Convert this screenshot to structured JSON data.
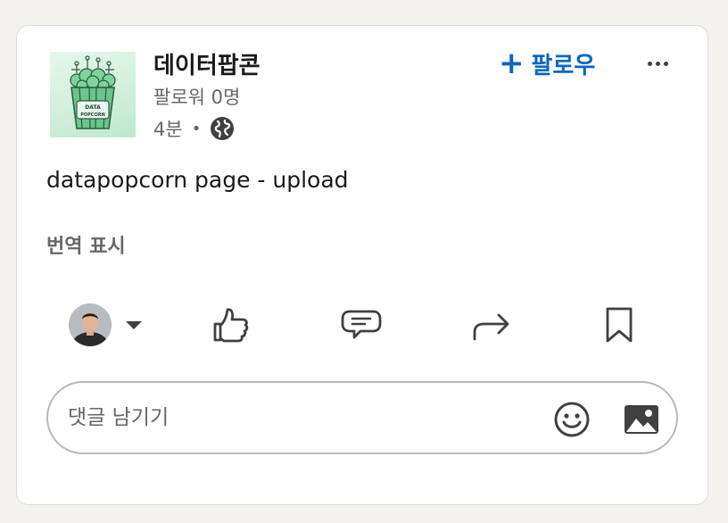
{
  "post": {
    "author_name": "데이터팝콘",
    "followers": "팔로워 0명",
    "time": "4분",
    "separator": "•",
    "visibility_icon": "globe-icon",
    "follow_label": "팔로우",
    "follow_icon": "plus-icon",
    "more_icon": "ellipsis-icon",
    "text": "datapopcorn page - upload",
    "translate_label": "번역 표시",
    "logo_text_line1": "DATA",
    "logo_text_line2": "POPCORN"
  },
  "actions": {
    "items": [
      "avatar-selector",
      "like-icon",
      "comment-icon",
      "repost-icon",
      "bookmark-icon"
    ]
  },
  "comment": {
    "placeholder": "댓글 남기기",
    "emoji_icon": "emoji-icon",
    "image_icon": "image-icon"
  },
  "colors": {
    "accent": "#0a66c2",
    "background": "#f3f2ef",
    "card": "#ffffff",
    "muted_text": "#666666"
  }
}
